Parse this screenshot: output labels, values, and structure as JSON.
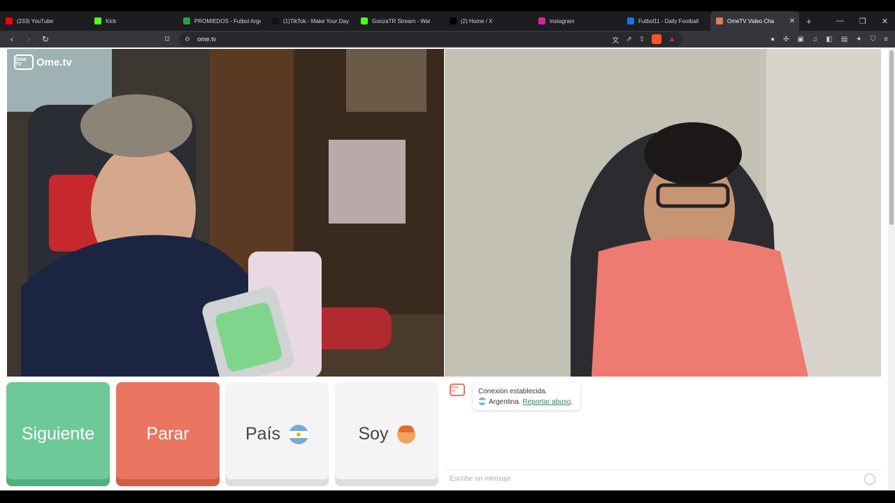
{
  "tabs": [
    {
      "label": "(233) YouTube",
      "color": "#ff0000",
      "icon": "youtube-icon"
    },
    {
      "label": "Kick",
      "color": "#53fc18",
      "icon": "kick-icon"
    },
    {
      "label": "PROMIEDOS - Futbol Arge",
      "color": "#2e9d4d",
      "icon": "promiedos-icon"
    },
    {
      "label": "(1)TikTok - Make Your Day",
      "color": "#111111",
      "icon": "tiktok-icon"
    },
    {
      "label": "GonzaTR Stream - Wat",
      "color": "#53fc18",
      "icon": "kick-icon"
    },
    {
      "label": "(2) Home / X",
      "color": "#000000",
      "icon": "x-icon"
    },
    {
      "label": "Instagram",
      "color": "#d6249f",
      "icon": "instagram-icon"
    },
    {
      "label": "Futbol11 - Daily Football",
      "color": "#1a73e8",
      "icon": "futbol11-icon"
    },
    {
      "label": "OmeTV Video Cha",
      "color": "#ea7560",
      "icon": "ometv-icon",
      "active": true
    }
  ],
  "browser": {
    "url": "ome.tv",
    "new_tab": "+",
    "min": "—",
    "max": "❐",
    "close": "✕"
  },
  "logo": {
    "badge": "Ome TV",
    "text": "Ome.tv"
  },
  "buttons": {
    "next": "Siguiente",
    "stop": "Parar",
    "country": "País",
    "soy": "Soy"
  },
  "chat": {
    "logo": "Ome TV",
    "connected": "Conexión establecida.",
    "country": "Argentina.",
    "report": "Reportar abuso",
    "report_suffix": ".",
    "placeholder": "Escribe un mensaje"
  }
}
